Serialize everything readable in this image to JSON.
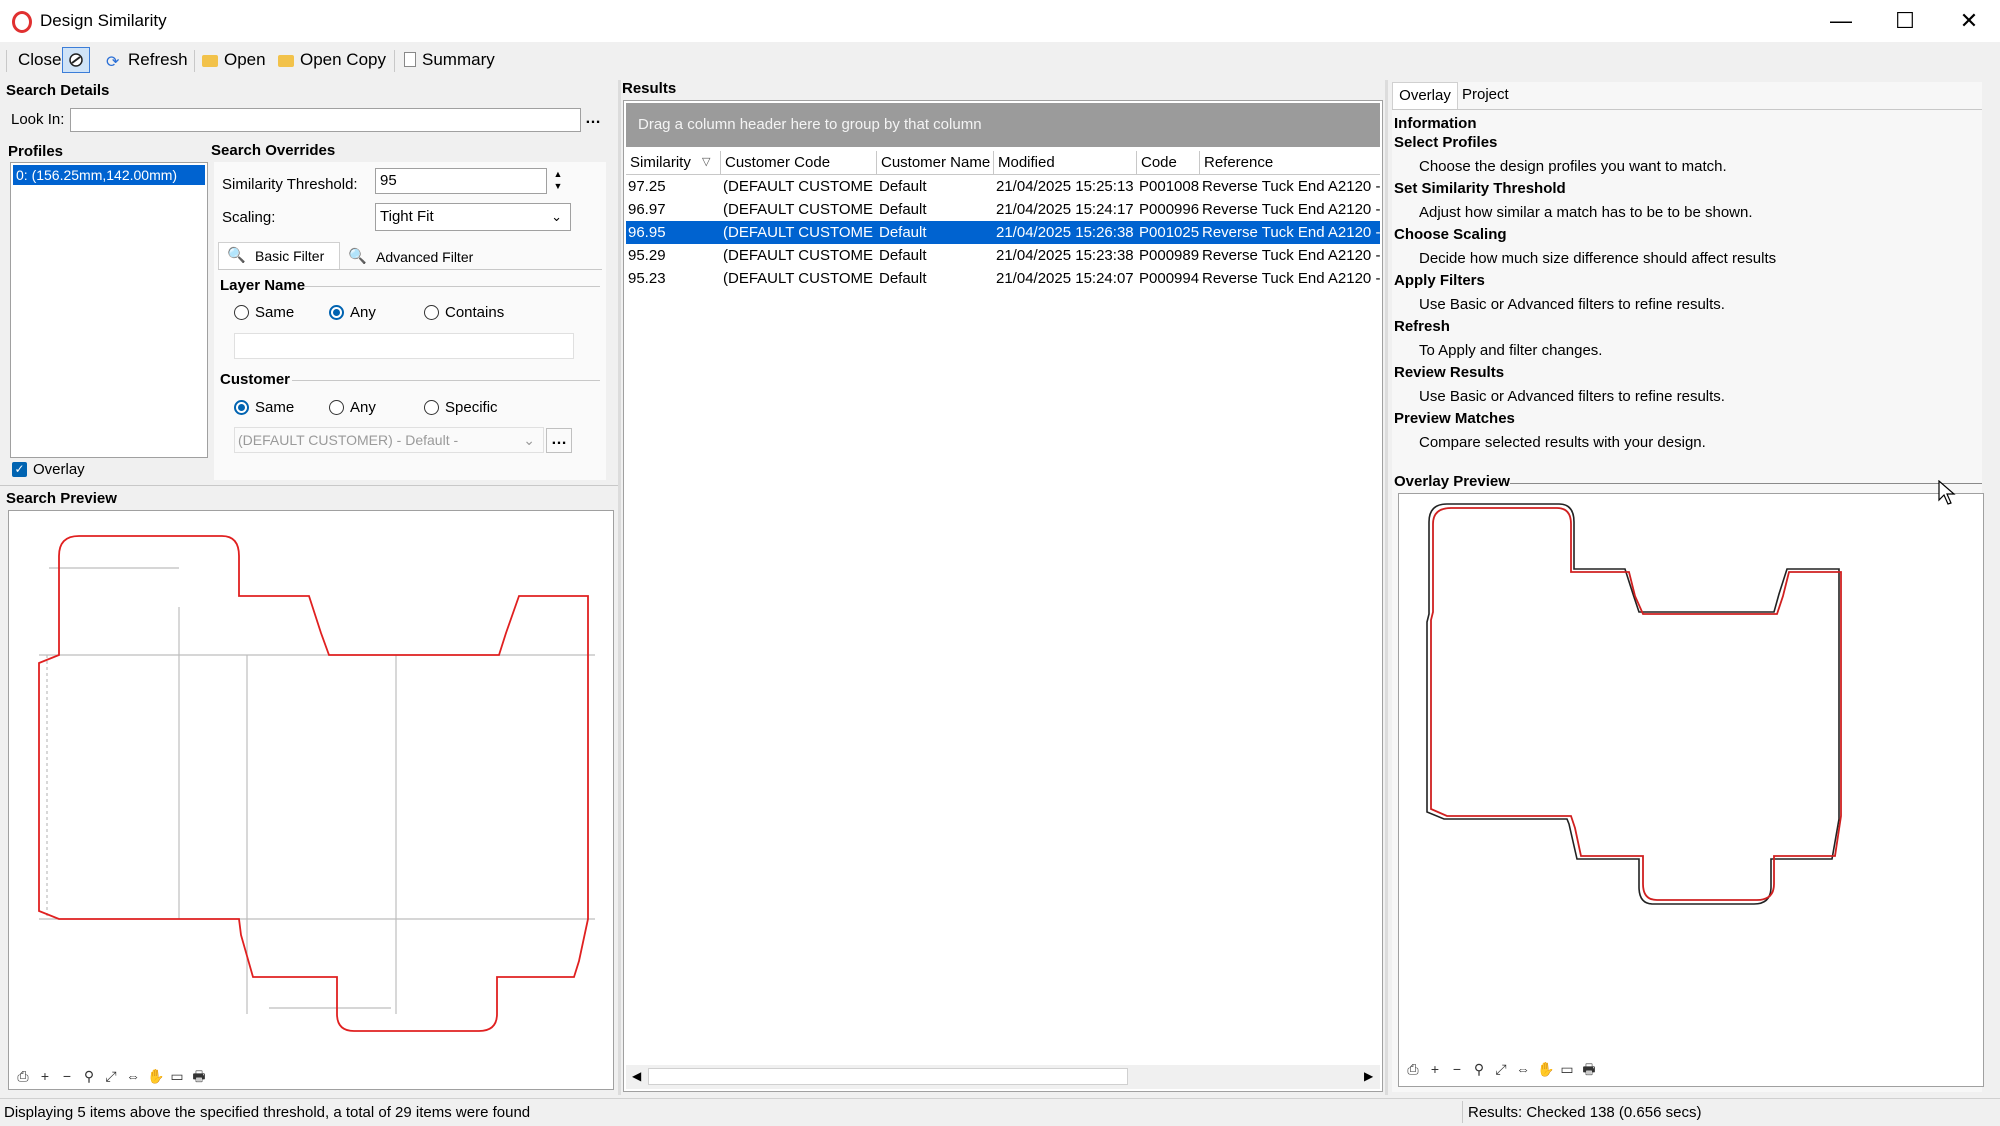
{
  "window": {
    "title": "Design Similarity",
    "minimize": "—",
    "maximize": "☐",
    "close": "✕"
  },
  "toolbar": {
    "close": "Close",
    "refresh": "Refresh",
    "open": "Open",
    "open_copy": "Open Copy",
    "summary": "Summary"
  },
  "search_details": {
    "header": "Search Details",
    "look_in_label": "Look In:",
    "look_in_value": "",
    "browse": "…",
    "profiles_label": "Profiles",
    "profiles": [
      "0: (156.25mm,142.00mm)"
    ],
    "overlay_label": "Overlay",
    "overlay_checked": true
  },
  "overrides": {
    "header": "Search Overrides",
    "threshold_label": "Similarity Threshold:",
    "threshold_value": "95",
    "scaling_label": "Scaling:",
    "scaling_value": "Tight Fit",
    "tabs": [
      "Basic Filter",
      "Advanced Filter"
    ],
    "layer_name": {
      "header": "Layer Name",
      "options": [
        "Same",
        "Any",
        "Contains"
      ],
      "selected": "Any",
      "text": ""
    },
    "customer": {
      "header": "Customer",
      "options": [
        "Same",
        "Any",
        "Specific"
      ],
      "selected": "Same",
      "select_value": "(DEFAULT CUSTOMER) - Default -",
      "browse": "…"
    }
  },
  "search_preview": {
    "header": "Search Preview"
  },
  "results": {
    "header": "Results",
    "group_hint": "Drag a column header here to group by that column",
    "columns": [
      "Similarity",
      "Customer Code",
      "Customer Name",
      "Modified",
      "Code",
      "Reference"
    ],
    "rows": [
      [
        "97.25",
        "(DEFAULT CUSTOMER)",
        "Default",
        "21/04/2025 15:25:13",
        "P001008",
        "Reverse Tuck End A2120 -"
      ],
      [
        "96.97",
        "(DEFAULT CUSTOMER)",
        "Default",
        "21/04/2025 15:24:17",
        "P000996",
        "Reverse Tuck End A2120 -"
      ],
      [
        "96.95",
        "(DEFAULT CUSTOMER)",
        "Default",
        "21/04/2025 15:26:38",
        "P001025",
        "Reverse Tuck End A2120 -"
      ],
      [
        "95.29",
        "(DEFAULT CUSTOMER)",
        "Default",
        "21/04/2025 15:23:38",
        "P000989",
        "Reverse Tuck End A2120 -"
      ],
      [
        "95.23",
        "(DEFAULT CUSTOMER)",
        "Default",
        "21/04/2025 15:24:07",
        "P000994",
        "Reverse Tuck End A2120 -"
      ]
    ],
    "selected_row": 2
  },
  "right_panel": {
    "tabs": [
      "Overlay",
      "Project"
    ],
    "info_header": "Information",
    "items": [
      {
        "title": "Select Profiles",
        "text": "Choose the design profiles you want to match."
      },
      {
        "title": "Set Similarity Threshold",
        "text": "Adjust how similar a match has to be to be shown."
      },
      {
        "title": "Choose Scaling",
        "text": "Decide how much size difference should affect results"
      },
      {
        "title": "Apply Filters",
        "text": "Use Basic or Advanced filters to refine results."
      },
      {
        "title": "Refresh",
        "text": "To Apply and filter changes."
      },
      {
        "title": "Review Results",
        "text": "Use Basic or Advanced filters to refine results."
      },
      {
        "title": "Preview Matches",
        "text": "Compare selected results with your design."
      }
    ],
    "overlay_preview": "Overlay Preview"
  },
  "status": {
    "left": "Displaying 5 items above the specified threshold, a total of 29 items were found",
    "right": "Results: Checked 138 (0.656 secs)"
  },
  "colors": {
    "accent": "#0063d0",
    "cut_line": "#e02020",
    "crease_line": "#bdbdbd"
  }
}
